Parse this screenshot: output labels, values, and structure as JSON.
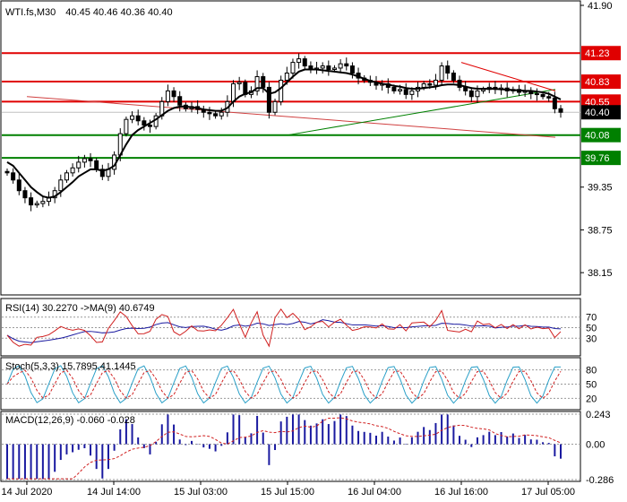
{
  "chart_data": {
    "type": "candlestick",
    "symbol_header": "WTI.fs,M30",
    "ohlc_header": "40.45 40.46 40.36 40.40",
    "price_axis": {
      "ylim": [
        37.85,
        41.95
      ],
      "ticks": [
        "41.90",
        "41.23",
        "40.83",
        "40.55",
        "40.40",
        "40.08",
        "39.76",
        "39.35",
        "38.75",
        "38.15"
      ]
    },
    "time_axis": {
      "ticks": [
        "14 Jul 2020",
        "14 Jul 14:00",
        "15 Jul 03:00",
        "15 Jul 15:00",
        "16 Jul 04:00",
        "16 Jul 16:00",
        "17 Jul 05:00"
      ]
    },
    "current_price": "40.40",
    "levels": [
      {
        "value": 41.23,
        "label": "41.23",
        "color": "#e00000"
      },
      {
        "value": 40.83,
        "label": "40.83",
        "color": "#e00000"
      },
      {
        "value": 40.55,
        "label": "40.55",
        "color": "#e00000"
      },
      {
        "value": 40.08,
        "label": "40.08",
        "color": "#008000"
      },
      {
        "value": 39.76,
        "label": "39.76",
        "color": "#008000"
      }
    ],
    "close_series": [
      39.55,
      39.45,
      39.3,
      39.2,
      39.1,
      39.12,
      39.15,
      39.2,
      39.3,
      39.45,
      39.55,
      39.62,
      39.7,
      39.75,
      39.72,
      39.6,
      39.5,
      39.6,
      39.8,
      40.1,
      40.3,
      40.35,
      40.28,
      40.22,
      40.2,
      40.35,
      40.55,
      40.7,
      40.62,
      40.5,
      40.45,
      40.48,
      40.44,
      40.4,
      40.38,
      40.35,
      40.4,
      40.55,
      40.8,
      40.82,
      40.65,
      40.7,
      40.9,
      40.75,
      40.4,
      40.55,
      40.85,
      40.95,
      41.1,
      41.15,
      41.05,
      41.0,
      41.02,
      41.05,
      41.0,
      41.02,
      41.08,
      41.05,
      40.95,
      40.88,
      40.85,
      40.82,
      40.78,
      40.8,
      40.75,
      40.7,
      40.72,
      40.65,
      40.7,
      40.75,
      40.8,
      40.78,
      40.85,
      41.05,
      40.95,
      40.85,
      40.75,
      40.7,
      40.62,
      40.7,
      40.72,
      40.75,
      40.72,
      40.74,
      40.7,
      40.72,
      40.68,
      40.7,
      40.66,
      40.65,
      40.62,
      40.6,
      40.45,
      40.4
    ],
    "ma_series": [
      39.7,
      39.65,
      39.55,
      39.45,
      39.35,
      39.28,
      39.22,
      39.2,
      39.22,
      39.28,
      39.35,
      39.42,
      39.5,
      39.55,
      39.6,
      39.6,
      39.58,
      39.6,
      39.65,
      39.8,
      39.95,
      40.08,
      40.15,
      40.2,
      40.25,
      40.3,
      40.36,
      40.42,
      40.46,
      40.48,
      40.48,
      40.47,
      40.46,
      40.44,
      40.43,
      40.42,
      40.42,
      40.46,
      40.55,
      40.62,
      40.66,
      40.68,
      40.74,
      40.74,
      40.66,
      40.68,
      40.74,
      40.82,
      40.9,
      40.97,
      41.0,
      41.0,
      41.0,
      40.99,
      40.98,
      40.97,
      40.96,
      40.95,
      40.93,
      40.9,
      40.87,
      40.84,
      40.82,
      40.8,
      40.79,
      40.77,
      40.76,
      40.74,
      40.73,
      40.73,
      40.74,
      40.75,
      40.76,
      40.78,
      40.79,
      40.79,
      40.78,
      40.76,
      40.74,
      40.73,
      40.73,
      40.73,
      40.73,
      40.72,
      40.72,
      40.71,
      40.71,
      40.7,
      40.7,
      40.69,
      40.68,
      40.66,
      40.62,
      40.58
    ],
    "trendlines": [
      {
        "from": [
          "14 Jul 2020",
          40.62
        ],
        "to": [
          "17 Jul 05:00",
          40.05
        ],
        "color": "#d04040"
      },
      {
        "from": [
          "15 Jul 15:00",
          40.08
        ],
        "to": [
          "17 Jul 05:00",
          40.72
        ],
        "color": "#008000"
      },
      {
        "from": [
          "16 Jul 16:00",
          41.1
        ],
        "to": [
          "17 Jul 05:00",
          40.7
        ],
        "color": "#e00000"
      }
    ],
    "indicators": {
      "rsi": {
        "label": "RSI(14) 30.2270  ->MA(9) 40.6749",
        "levels": [
          "70",
          "50",
          "30"
        ],
        "ylim": [
          0,
          100
        ]
      },
      "stoch": {
        "label": "Stoch(5,3,3) 15.7895,41.1445",
        "levels": [
          "80",
          "50",
          "20"
        ],
        "ylim": [
          0,
          100
        ]
      },
      "macd": {
        "label": "MACD(12,26,9) -0.060 -0.028",
        "levels": [
          "0.243",
          "0.00",
          "-0.286"
        ],
        "ylim": [
          -0.286,
          0.243
        ]
      }
    }
  }
}
